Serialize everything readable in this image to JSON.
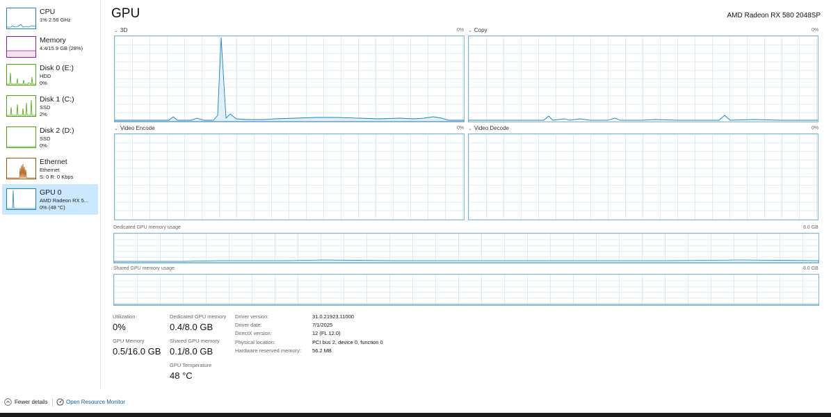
{
  "sidebar": {
    "items": [
      {
        "title": "CPU",
        "lines": [
          "1% 2.56 GHz"
        ],
        "color": "#1983c2"
      },
      {
        "title": "Memory",
        "lines": [
          "4.4/15.9 GB (28%)"
        ],
        "color": "#8b1d8b"
      },
      {
        "title": "Disk 0 (E:)",
        "lines": [
          "HDD",
          "0%"
        ],
        "color": "#4da60c"
      },
      {
        "title": "Disk 1 (C:)",
        "lines": [
          "SSD",
          "2%"
        ],
        "color": "#4da60c"
      },
      {
        "title": "Disk 2 (D:)",
        "lines": [
          "SSD",
          "0%"
        ],
        "color": "#4da60c"
      },
      {
        "title": "Ethernet",
        "lines": [
          "Ethernet",
          "S: 0 R: 0 Kbps"
        ],
        "color": "#a74f01"
      },
      {
        "title": "GPU 0",
        "lines": [
          "AMD Radeon RX 5...",
          "0% (48 °C)"
        ],
        "color": "#1983c2",
        "selected": true
      }
    ]
  },
  "header": {
    "title": "GPU",
    "device": "AMD Radeon RX 580 2048SP"
  },
  "engines": [
    {
      "label": "3D",
      "percent": "0%"
    },
    {
      "label": "Copy",
      "percent": "0%"
    },
    {
      "label": "Video Encode",
      "percent": "0%"
    },
    {
      "label": "Video Decode",
      "percent": "0%"
    }
  ],
  "memory_graphs": [
    {
      "label": "Dedicated GPU memory usage",
      "max": "8.0 GB"
    },
    {
      "label": "Shared GPU memory usage",
      "max": "8.0 GB"
    }
  ],
  "stats": {
    "utilization": {
      "label": "Utilization",
      "value": "0%"
    },
    "gpu_memory": {
      "label": "GPU Memory",
      "value": "0.5/16.0 GB"
    },
    "dedicated": {
      "label": "Dedicated GPU memory",
      "value": "0.4/8.0 GB"
    },
    "shared": {
      "label": "Shared GPU memory",
      "value": "0.1/8.0 GB"
    },
    "temperature": {
      "label": "GPU Temperature",
      "value": "48 °C"
    }
  },
  "properties": [
    {
      "key": "Driver version:",
      "value": "31.0.21923.11000"
    },
    {
      "key": "Driver date:",
      "value": "7/1/2025"
    },
    {
      "key": "DirectX version:",
      "value": "12 (FL 12.0)"
    },
    {
      "key": "Physical location:",
      "value": "PCI bus 2, device 0, function 0"
    },
    {
      "key": "Hardware reserved memory:",
      "value": "56.2 MB"
    }
  ],
  "footer": {
    "fewer_details": "Fewer details",
    "open_resource_monitor": "Open Resource Monitor"
  },
  "colors": {
    "gpu_line": "#1983c2",
    "graph_border": "#82b6d4",
    "selected_bg": "#cce8ff",
    "link": "#0e5fa8"
  }
}
